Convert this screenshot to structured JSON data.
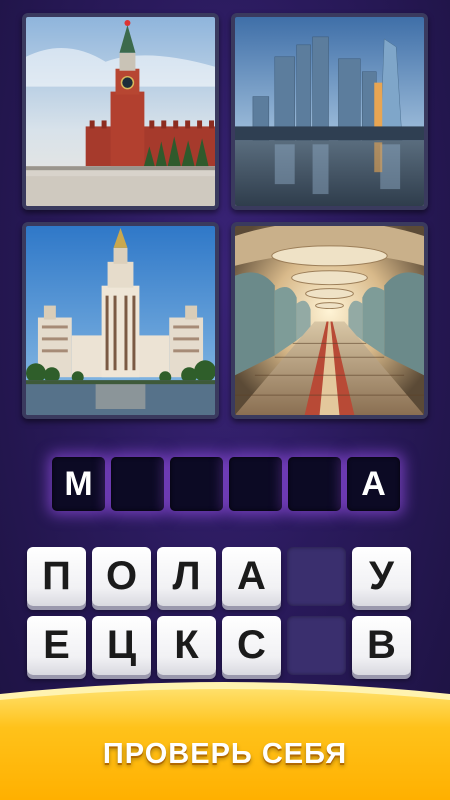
{
  "answer": {
    "slots": [
      "М",
      "",
      "",
      "",
      "",
      "А"
    ]
  },
  "letters": {
    "row1": [
      "П",
      "О",
      "Л",
      "А",
      "",
      "У"
    ],
    "row2": [
      "Е",
      "Ц",
      "К",
      "С",
      "",
      "В"
    ]
  },
  "banner": {
    "cta": "ПРОВЕРЬ СЕБЯ"
  },
  "colors": {
    "background": "#2a1a5c",
    "slot_glow": "#aa5aff",
    "banner": "#ffc21a"
  }
}
